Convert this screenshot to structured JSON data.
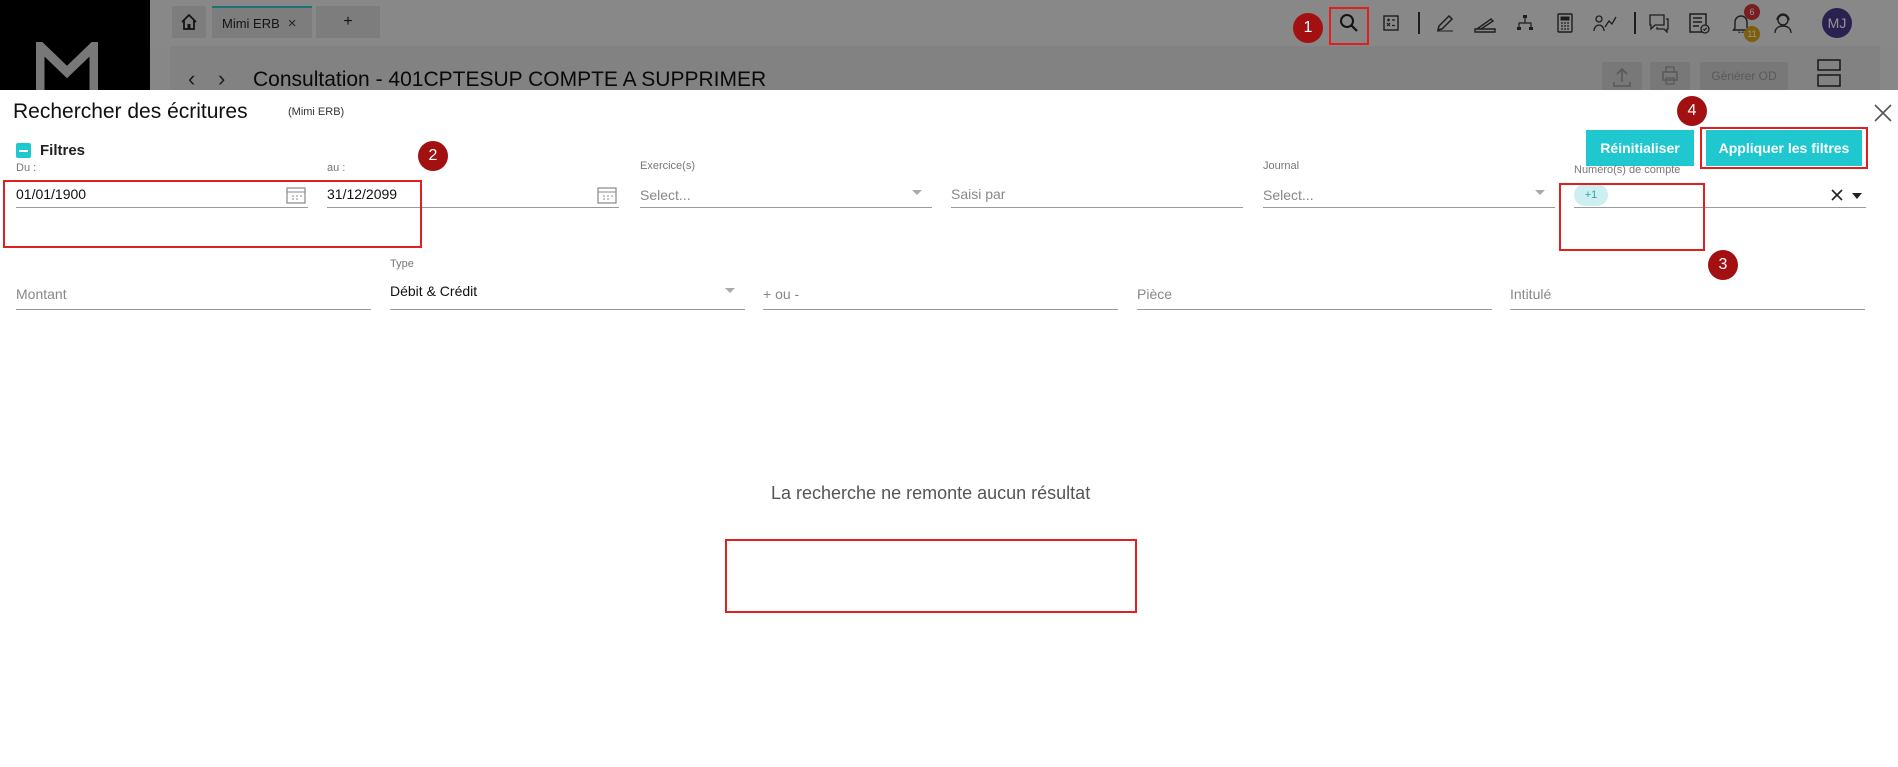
{
  "app": {
    "tab_label": "Mimi ERB",
    "tab_add_label": "+",
    "page_title": "Consultation - 401CPTESUP COMPTE A SUPPRIMER",
    "generate_od_label": "Générer OD",
    "notif_count_red": "6",
    "notif_count_yellow": "11",
    "avatar_initials": "MJ"
  },
  "panel": {
    "title": "Rechercher des écritures",
    "subtitle": "(Mimi ERB)",
    "filters_label": "Filtres",
    "reset_label": "Réinitialiser",
    "apply_label": "Appliquer les filtres"
  },
  "fields": {
    "date_from_label": "Du :",
    "date_from_value": "01/01/1900",
    "date_to_label": "au :",
    "date_to_value": "31/12/2099",
    "exercice_label": "Exercice(s)",
    "exercice_placeholder": "Select...",
    "saisi_par_placeholder": "Saisi par",
    "journal_label": "Journal",
    "journal_placeholder": "Select...",
    "compte_label": "Numéro(s) de compte",
    "compte_chip": "+1",
    "montant_placeholder": "Montant",
    "type_label": "Type",
    "type_value": "Débit & Crédit",
    "sign_placeholder": "+ ou -",
    "piece_placeholder": "Pièce",
    "intitule_placeholder": "Intitulé"
  },
  "results": {
    "empty_message": "La recherche ne remonte aucun résultat"
  },
  "annotations": {
    "markers": [
      "1",
      "2",
      "3",
      "4"
    ],
    "color": "#e02020",
    "marker_color": "#a21012"
  },
  "colors": {
    "accent": "#1fc7cf"
  }
}
